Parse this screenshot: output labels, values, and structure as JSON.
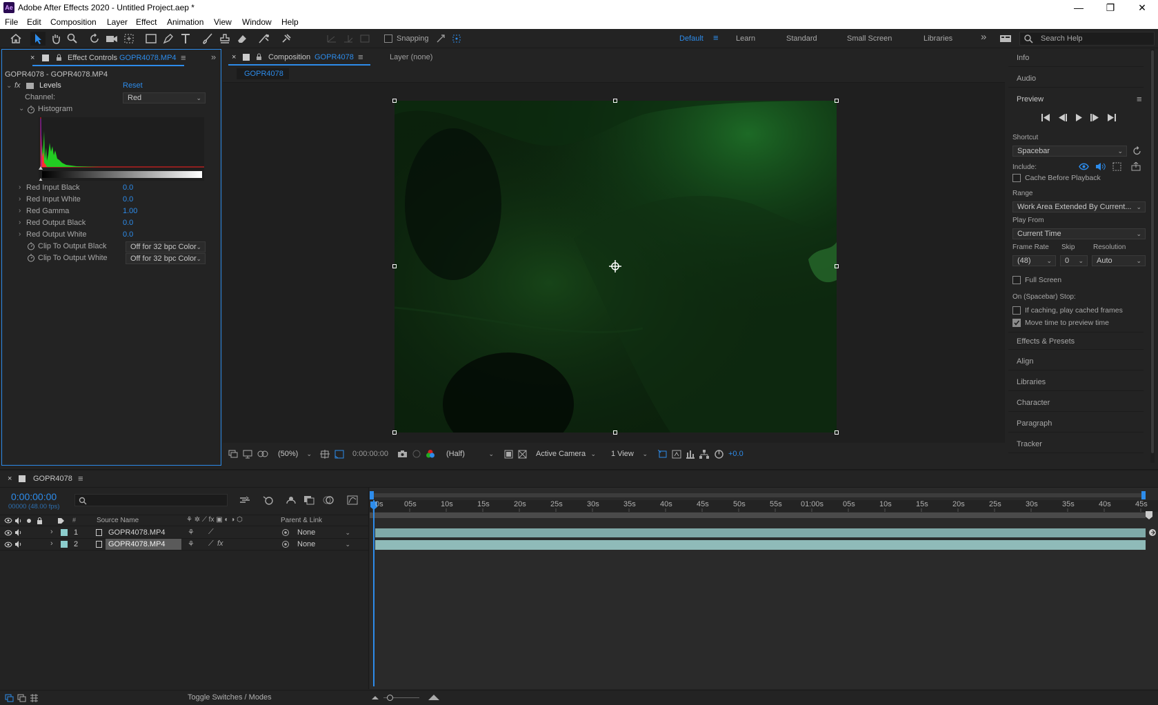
{
  "window": {
    "app_icon_text": "Ae",
    "title": "Adobe After Effects 2020 - Untitled Project.aep *",
    "min_glyph": "—",
    "max_glyph": "❐",
    "close_glyph": "✕"
  },
  "menu": [
    "File",
    "Edit",
    "Composition",
    "Layer",
    "Effect",
    "Animation",
    "View",
    "Window",
    "Help"
  ],
  "toolbar": {
    "snapping_label": "Snapping",
    "workspaces": [
      "Default",
      "Learn",
      "Standard",
      "Small Screen",
      "Libraries"
    ],
    "active_workspace": "Default",
    "more_glyph": "»",
    "search_placeholder": "Search Help"
  },
  "effect_controls": {
    "tab_label": "Effect Controls",
    "tab_file": "GOPR4078.MP4",
    "layer_path": "GOPR4078 - GOPR4078.MP4",
    "effect_name": "Levels",
    "reset_label": "Reset",
    "channel_label": "Channel:",
    "channel_value": "Red",
    "histogram_label": "Histogram",
    "properties": [
      {
        "label": "Red Input Black",
        "value": "0.0"
      },
      {
        "label": "Red Input White",
        "value": "0.0"
      },
      {
        "label": "Red Gamma",
        "value": "1.00"
      },
      {
        "label": "Red Output Black",
        "value": "0.0"
      },
      {
        "label": "Red Output White",
        "value": "0.0"
      }
    ],
    "clip_black_label": "Clip To Output Black",
    "clip_black_value": "Off for 32 bpc Color",
    "clip_white_label": "Clip To Output White",
    "clip_white_value": "Off for 32 bpc Color"
  },
  "composition": {
    "tab_label": "Composition",
    "tab_name": "GOPR4078",
    "layer_tab": "Layer (none)",
    "comp_button": "GOPR4078",
    "zoom": "(50%)",
    "timecode": "0:00:00:00",
    "resolution": "(Half)",
    "camera": "Active Camera",
    "views": "1 View",
    "exposure": "+0.0"
  },
  "right_panel": {
    "info": "Info",
    "audio": "Audio",
    "preview": "Preview",
    "shortcut_label": "Shortcut",
    "shortcut_value": "Spacebar",
    "include_label": "Include:",
    "cache_label": "Cache Before Playback",
    "range_label": "Range",
    "range_value": "Work Area Extended By Current...",
    "play_from_label": "Play From",
    "play_from_value": "Current Time",
    "frame_rate_label": "Frame Rate",
    "skip_label": "Skip",
    "resolution_label": "Resolution",
    "frame_rate_value": "(48)",
    "skip_value": "0",
    "resolution_value": "Auto",
    "full_screen_label": "Full Screen",
    "on_stop_label": "On (Spacebar) Stop:",
    "if_caching_label": "If caching, play cached frames",
    "move_time_label": "Move time to preview time",
    "sections": [
      "Effects & Presets",
      "Align",
      "Libraries",
      "Character",
      "Paragraph",
      "Tracker"
    ]
  },
  "timeline": {
    "tab_name": "GOPR4078",
    "timecode": "0:00:00:00",
    "frames_fps": "00000 (48.00 fps)",
    "search_placeholder": "",
    "col_source_name": "Source Name",
    "col_parent": "Parent & Link",
    "col_hash": "#",
    "layers": [
      {
        "num": "1",
        "name": "GOPR4078.MP4",
        "parent": "None"
      },
      {
        "num": "2",
        "name": "GOPR4078.MP4",
        "parent": "None"
      }
    ],
    "ruler_labels": [
      "0s",
      "05s",
      "10s",
      "15s",
      "20s",
      "25s",
      "30s",
      "35s",
      "40s",
      "45s",
      "50s",
      "55s",
      "01:00s",
      "05s",
      "10s",
      "15s",
      "20s",
      "25s",
      "30s",
      "35s",
      "40s",
      "45s"
    ],
    "toggle_label": "Toggle Switches / Modes"
  },
  "colors": {
    "accent": "#2d8ceb",
    "panel_bg": "#232323",
    "clip_bar": "#7fa9a8",
    "histogram_red": "#d42020",
    "histogram_green": "#22cc22"
  }
}
